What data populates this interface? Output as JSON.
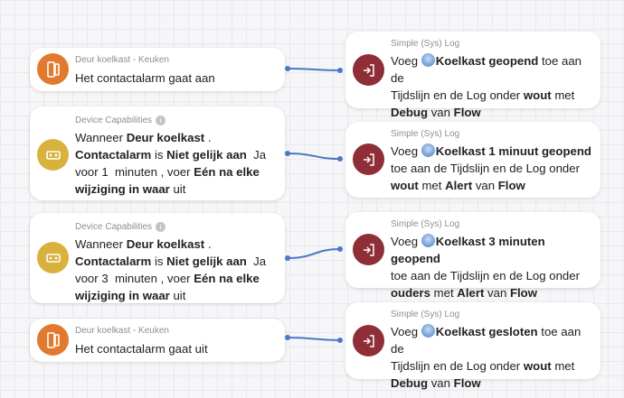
{
  "triggers": [
    {
      "subtitle": "Deur koelkast - Keuken",
      "icon": "door-sensor-icon",
      "color": "#e17a2e",
      "line1": "Het contactalarm gaat aan"
    },
    {
      "subtitle": "Device Capabilities",
      "icon": "capability-icon",
      "color": "#d8b23c",
      "w1": "Wanneer",
      "device": "Deur koelkast",
      "dot": ".",
      "capability": "Contactalarm",
      "is": "is",
      "op": "Niet gelijk aan",
      "val": "Ja",
      "voor": "voor",
      "num": "1",
      "unit": "minuten",
      "voer": ", voer",
      "mode": "Eén na elke",
      "end_b": "wijziging in waar",
      "end": "uit"
    },
    {
      "subtitle": "Device Capabilities",
      "icon": "capability-icon",
      "color": "#d8b23c",
      "w1": "Wanneer",
      "device": "Deur koelkast",
      "dot": ".",
      "capability": "Contactalarm",
      "is": "is",
      "op": "Niet gelijk aan",
      "val": "Ja",
      "voor": "voor",
      "num": "3",
      "unit": "minuten",
      "voer": ", voer",
      "mode": "Eén na elke",
      "end_b": "wijziging in waar",
      "end": "uit"
    },
    {
      "subtitle": "Deur koelkast - Keuken",
      "icon": "door-sensor-icon",
      "color": "#e17a2e",
      "line1": "Het contactalarm gaat uit"
    }
  ],
  "actions": [
    {
      "subtitle": "Simple (Sys) Log",
      "icon": "log-icon",
      "color": "#8f2e36",
      "voeg": "Voeg",
      "msg": "Koelkast geopend",
      "rest1": "toe aan de",
      "line2": "Tijdslijn en de Log onder",
      "group": "wout",
      "met": "met",
      "level": "Debug",
      "van": "van",
      "flow": "Flow"
    },
    {
      "subtitle": "Simple (Sys) Log",
      "icon": "log-icon",
      "color": "#8f2e36",
      "voeg": "Voeg",
      "msg": "Koelkast 1 minuut geopend",
      "line2": "toe aan de Tijdslijn en de Log onder",
      "group": "wout",
      "met": "met",
      "level": "Alert",
      "van": "van",
      "flow": "Flow"
    },
    {
      "subtitle": "Simple (Sys) Log",
      "icon": "log-icon",
      "color": "#8f2e36",
      "voeg": "Voeg",
      "msg": "Koelkast 3 minuten geopend",
      "line2": "toe aan de Tijdslijn en de Log onder",
      "group": "ouders",
      "met": "met",
      "level": "Alert",
      "van": "van",
      "flow": "Flow"
    },
    {
      "subtitle": "Simple (Sys) Log",
      "icon": "log-icon",
      "color": "#8f2e36",
      "voeg": "Voeg",
      "msg": "Koelkast gesloten",
      "rest1": "toe aan de",
      "line2": "Tijdslijn en de Log onder",
      "group": "wout",
      "met": "met",
      "level": "Debug",
      "van": "van",
      "flow": "Flow"
    }
  ],
  "connector_color": "#4b78c8"
}
